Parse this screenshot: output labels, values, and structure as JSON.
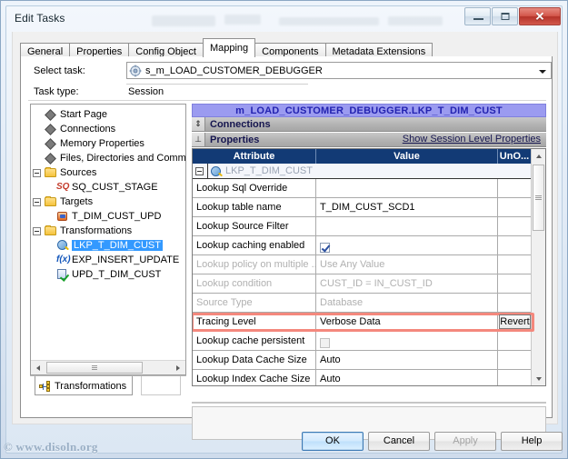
{
  "window": {
    "title": "Edit Tasks",
    "caption_buttons": [
      {
        "name": "minimize",
        "glyph": ""
      },
      {
        "name": "maximize",
        "glyph": ""
      },
      {
        "name": "close",
        "glyph": "✕"
      }
    ]
  },
  "tabs": [
    {
      "label": "General",
      "active": false
    },
    {
      "label": "Properties",
      "active": false
    },
    {
      "label": "Config Object",
      "active": false
    },
    {
      "label": "Mapping",
      "active": true
    },
    {
      "label": "Components",
      "active": false
    },
    {
      "label": "Metadata Extensions",
      "active": false
    }
  ],
  "form": {
    "select_task_label": "Select task:",
    "select_task_value": "s_m_LOAD_CUSTOMER_DEBUGGER",
    "task_type_label": "Task type:",
    "task_type_value": "Session"
  },
  "tree": {
    "items": [
      {
        "label": "Start Page",
        "icon": "diamond-icon",
        "indent": 1,
        "expander": false,
        "selected": false
      },
      {
        "label": "Connections",
        "icon": "diamond-icon",
        "indent": 1,
        "expander": false,
        "selected": false
      },
      {
        "label": "Memory Properties",
        "icon": "diamond-icon",
        "indent": 1,
        "expander": false,
        "selected": false
      },
      {
        "label": "Files, Directories and Comm",
        "icon": "diamond-icon",
        "indent": 1,
        "expander": false,
        "selected": false
      },
      {
        "label": "Sources",
        "icon": "folder-icon",
        "indent": 0,
        "expander": true,
        "selected": false
      },
      {
        "label": "SQ_CUST_STAGE",
        "icon": "sq-icon",
        "indent": 2,
        "expander": false,
        "selected": false
      },
      {
        "label": "Targets",
        "icon": "folder-icon",
        "indent": 0,
        "expander": true,
        "selected": false
      },
      {
        "label": "T_DIM_CUST_UPD",
        "icon": "target-icon",
        "indent": 2,
        "expander": false,
        "selected": false
      },
      {
        "label": "Transformations",
        "icon": "folder-icon",
        "indent": 0,
        "expander": true,
        "selected": false
      },
      {
        "label": "LKP_T_DIM_CUST",
        "icon": "lookup-icon",
        "indent": 2,
        "expander": false,
        "selected": true
      },
      {
        "label": "EXP_INSERT_UPDATE",
        "icon": "expression-icon",
        "indent": 2,
        "expander": false,
        "selected": false
      },
      {
        "label": "UPD_T_DIM_CUST",
        "icon": "update-icon",
        "indent": 2,
        "expander": false,
        "selected": false
      }
    ],
    "bottom_tab_label": "Transformations"
  },
  "properties": {
    "panel_title": "m_LOAD_CUSTOMER_DEBUGGER.LKP_T_DIM_CUST",
    "connections_band": "Connections",
    "properties_band": "Properties",
    "show_session_link": "Show Session Level Properties",
    "columns": [
      "Attribute",
      "Value",
      "UnO..."
    ],
    "node_row": "LKP_T_DIM_CUST",
    "rows": [
      {
        "attribute": "Lookup Sql Override",
        "value": "",
        "type": "text",
        "disabled": false,
        "highlighted": false,
        "unoverride": ""
      },
      {
        "attribute": "Lookup table name",
        "value": "T_DIM_CUST_SCD1",
        "type": "text",
        "disabled": false,
        "highlighted": false,
        "unoverride": ""
      },
      {
        "attribute": "Lookup Source Filter",
        "value": "",
        "type": "text",
        "disabled": false,
        "highlighted": false,
        "unoverride": ""
      },
      {
        "attribute": "Lookup caching enabled",
        "value": "",
        "type": "checkbox",
        "checked": true,
        "disabled": false,
        "highlighted": false,
        "unoverride": ""
      },
      {
        "attribute": "Lookup policy on multiple ...",
        "value": "Use Any Value",
        "type": "text",
        "disabled": true,
        "highlighted": false,
        "unoverride": ""
      },
      {
        "attribute": "Lookup condition",
        "value": "CUST_ID = IN_CUST_ID",
        "type": "text",
        "disabled": true,
        "highlighted": false,
        "unoverride": ""
      },
      {
        "attribute": "Source Type",
        "value": "Database",
        "type": "text",
        "disabled": true,
        "highlighted": false,
        "unoverride": ""
      },
      {
        "attribute": "Tracing Level",
        "value": "Verbose Data",
        "type": "text",
        "disabled": false,
        "highlighted": true,
        "unoverride": "Revert"
      },
      {
        "attribute": "Lookup cache persistent",
        "value": "",
        "type": "checkbox",
        "checked": false,
        "disabled": true,
        "highlighted": false,
        "unoverride": ""
      },
      {
        "attribute": "Lookup Data Cache Size",
        "value": "Auto",
        "type": "text",
        "disabled": false,
        "highlighted": false,
        "unoverride": ""
      },
      {
        "attribute": "Lookup Index Cache Size",
        "value": "Auto",
        "type": "text",
        "disabled": false,
        "highlighted": false,
        "unoverride": ""
      }
    ]
  },
  "buttons": {
    "ok": "OK",
    "cancel": "Cancel",
    "apply": "Apply",
    "help": "Help"
  },
  "watermark": "© www.disoln.org",
  "colors": {
    "title_band": "#9b9bf0",
    "grid_header": "#123a75",
    "selection": "#3399ff",
    "highlight": "#f4887d",
    "close_button": "#b53329"
  }
}
